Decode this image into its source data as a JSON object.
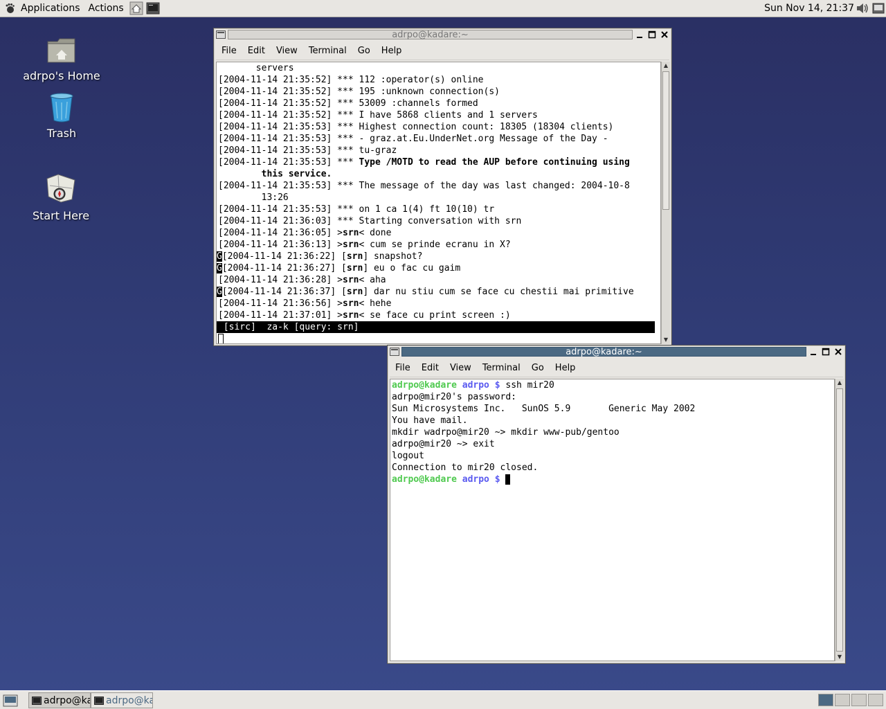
{
  "top_panel": {
    "applications": "Applications",
    "actions": "Actions",
    "clock": "Sun Nov 14, 21:37"
  },
  "desktop": {
    "home_label": "adrpo's Home",
    "trash_label": "Trash",
    "start_label": "Start Here"
  },
  "menus": [
    "File",
    "Edit",
    "View",
    "Terminal",
    "Go",
    "Help"
  ],
  "window1": {
    "title": "adrpo@kadare:~",
    "status": " [sirc]  za-k [query: srn]"
  },
  "window2": {
    "title": "adrpo@kadare:~"
  },
  "irc": {
    "l1": "       servers",
    "l2": "[2004-11-14 21:35:52] *** 112 :operator(s) online",
    "l3": "[2004-11-14 21:35:52] *** 195 :unknown connection(s)",
    "l4": "[2004-11-14 21:35:52] *** 53009 :channels formed",
    "l5": "[2004-11-14 21:35:52] *** I have 5868 clients and 1 servers",
    "l6": "[2004-11-14 21:35:53] *** Highest connection count: 18305 (18304 clients)",
    "l7": "[2004-11-14 21:35:53] *** - graz.at.Eu.UnderNet.org Message of the Day -",
    "l8": "[2004-11-14 21:35:53] *** tu-graz",
    "l9_prefix": "[2004-11-14 21:35:53] *** ",
    "l9_bold": "Type /MOTD to read the AUP before continuing using",
    "l10_bold": "        this service.",
    "l11": "[2004-11-14 21:35:53] *** The message of the day was last changed: 2004-10-8",
    "l12": "        13:26",
    "l13": "[2004-11-14 21:35:53] *** on 1 ca 1(4) ft 10(10) tr",
    "l14": "[2004-11-14 21:36:03] *** Starting conversation with srn",
    "l15_ts": "[2004-11-14 21:36:05] >",
    "l15_msg": "< done",
    "l16_ts": "[2004-11-14 21:36:13] >",
    "l16_msg": "< cum se prinde ecranu in X?",
    "l17_ts": "[2004-11-14 21:36:22] [",
    "l17_msg": "] snapshot?",
    "l18_ts": "[2004-11-14 21:36:27] [",
    "l18_msg": "] eu o fac cu gaim",
    "l19_ts": "[2004-11-14 21:36:28] >",
    "l19_msg": "< aha",
    "l20_ts": "[2004-11-14 21:36:37] [",
    "l20_msg": "] dar nu stiu cum se face cu chestii mai primitive",
    "l21_ts": "[2004-11-14 21:36:56] >",
    "l21_msg": "< hehe",
    "l22_ts": "[2004-11-14 21:37:01] >",
    "l22_msg": "< se face cu print screen :)",
    "nick": "srn",
    "g": "G"
  },
  "shell": {
    "user": "adrpo@kadare",
    "dir": "adrpo",
    "prompt": "$",
    "cmd1": " ssh mir20",
    "s2": "adrpo@mir20's password:",
    "s3": "Sun Microsystems Inc.   SunOS 5.9       Generic May 2002",
    "s4": "You have mail.",
    "s5": "mkdir wadrpo@mir20 ~> mkdir www-pub/gentoo",
    "s6": "adrpo@mir20 ~> exit",
    "s7": "logout",
    "s8": "Connection to mir20 closed."
  },
  "taskbar": {
    "task1": "adrpo@kadare:~",
    "task2": "adrpo@kadare:~"
  }
}
